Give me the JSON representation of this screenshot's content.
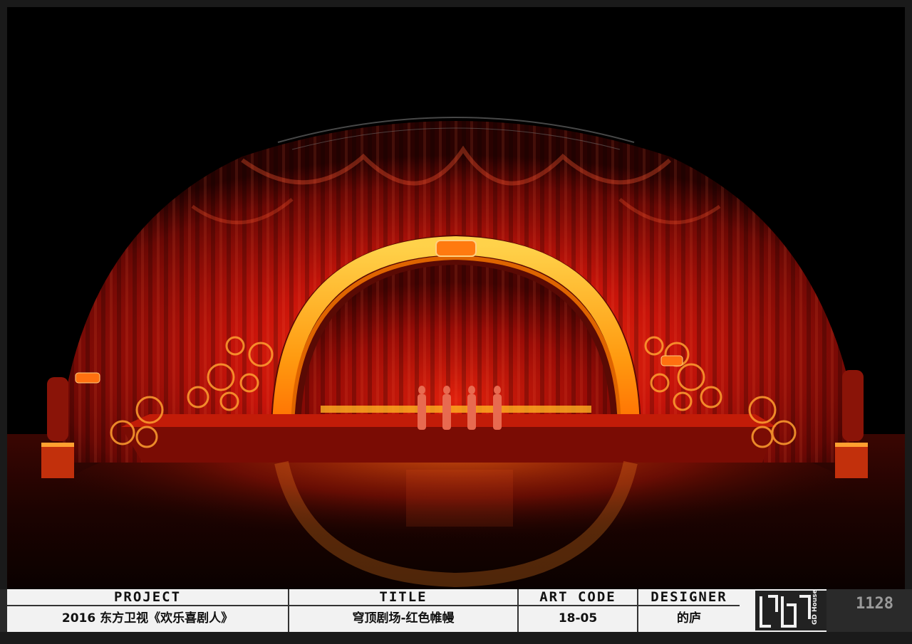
{
  "title_block": {
    "project_label": "PROJECT",
    "project_value": "2016 东方卫视《欢乐喜剧人》",
    "title_label": "TITLE",
    "title_value": "穹顶剧场-红色帷幔",
    "art_code_label": "ART CODE",
    "art_code_value": "18-05",
    "designer_label": "DESIGNER",
    "designer_value": "的庐",
    "logo_text": "GD House",
    "sheet_number": "1128"
  },
  "colors": {
    "background": "#000000",
    "curtain_red": "#b81208",
    "arch_gold": "#ffb000",
    "title_block_white": "#f2f2f2"
  }
}
